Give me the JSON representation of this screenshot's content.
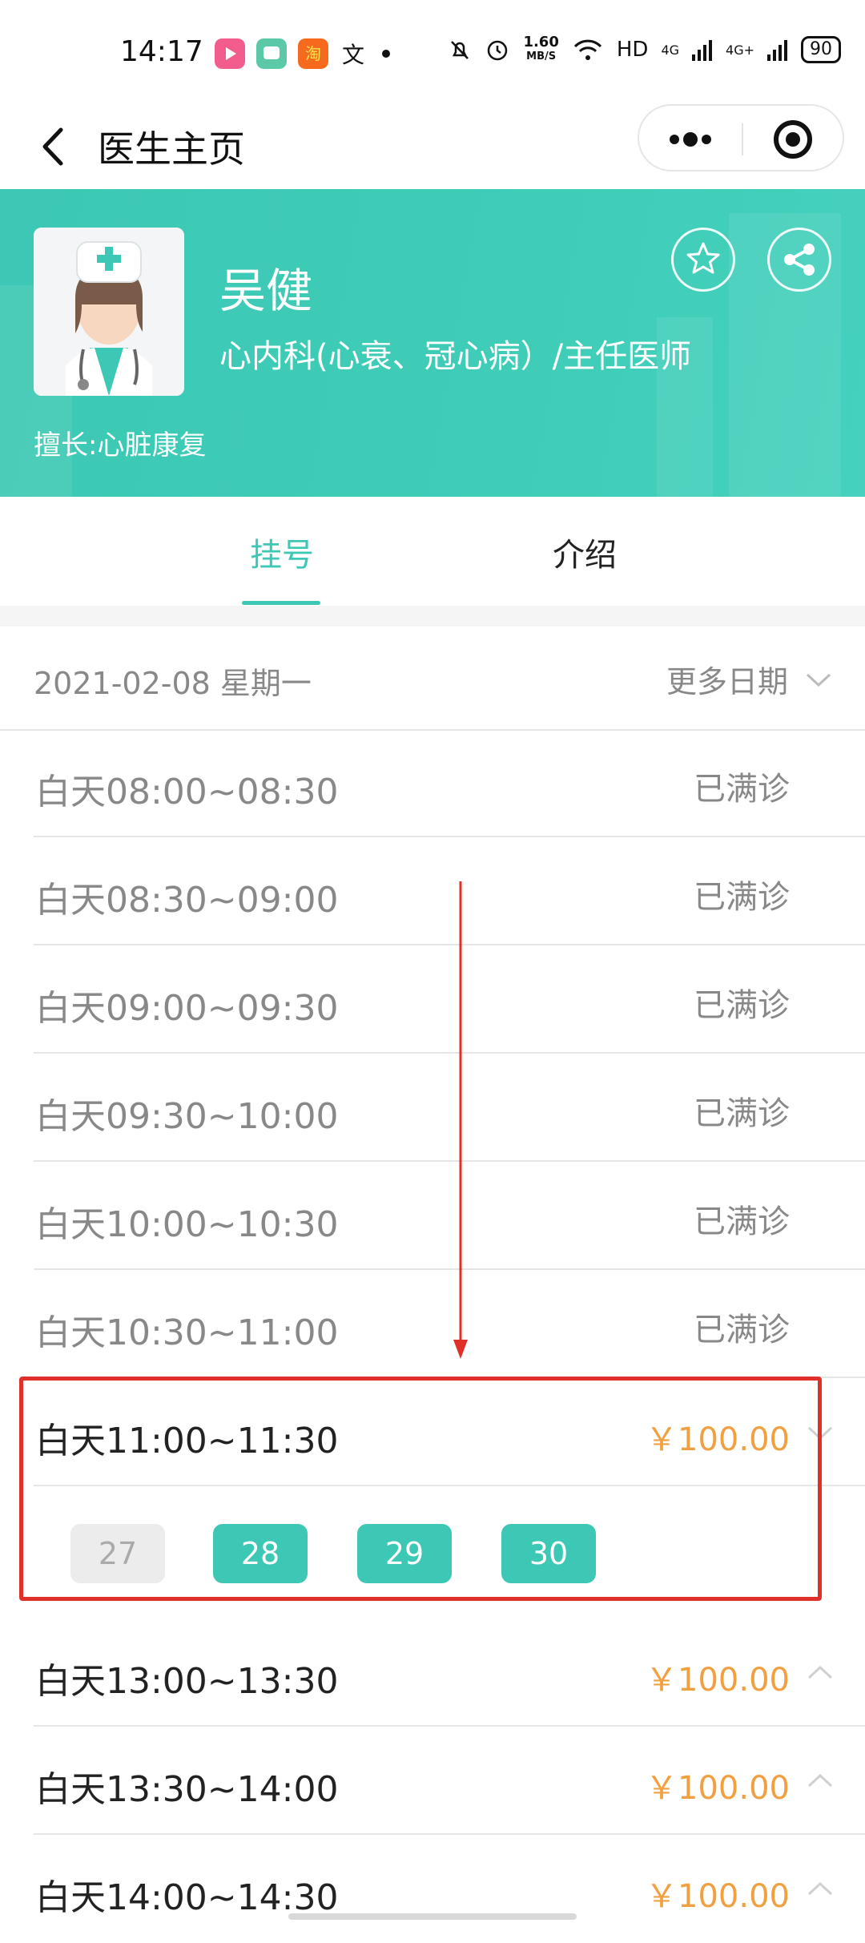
{
  "status_bar": {
    "time": "14:17",
    "net_speed_value": "1.60",
    "net_speed_unit": "MB/S",
    "network": "HD",
    "signal1": "4G",
    "signal2": "4G+",
    "battery": "90",
    "app_icons": [
      "bilibili-icon",
      "chat-app-icon",
      "taobao-icon",
      "translate-icon"
    ]
  },
  "nav": {
    "title": "医生主页",
    "more_icon": "more-dots-icon",
    "close_icon": "target-close-icon"
  },
  "doctor": {
    "name": "吴健",
    "department": "心内科(心衰、冠心病）/主任医师",
    "specialty": "擅长:心脏康复"
  },
  "tabs": [
    {
      "label": "挂号",
      "active": true
    },
    {
      "label": "介绍",
      "active": false
    }
  ],
  "date_bar": {
    "date": "2021-02-08 星期一",
    "more_label": "更多日期"
  },
  "slots": [
    {
      "time": "白天08:00~08:30",
      "status": "已满诊"
    },
    {
      "time": "白天08:30~09:00",
      "status": "已满诊"
    },
    {
      "time": "白天09:00~09:30",
      "status": "已满诊"
    },
    {
      "time": "白天09:30~10:00",
      "status": "已满诊"
    },
    {
      "time": "白天10:00~10:30",
      "status": "已满诊"
    },
    {
      "time": "白天10:30~11:00",
      "status": "已满诊"
    },
    {
      "time": "白天11:00~11:30",
      "price": "￥100.00",
      "expanded": true
    },
    {
      "time": "白天13:00~13:30",
      "price": "￥100.00"
    },
    {
      "time": "白天13:30~14:00",
      "price": "￥100.00"
    },
    {
      "time": "白天14:00~14:30",
      "price": "￥100.00"
    }
  ],
  "numbers": [
    {
      "label": "27",
      "available": false
    },
    {
      "label": "28",
      "available": true
    },
    {
      "label": "29",
      "available": true
    },
    {
      "label": "30",
      "available": true
    }
  ],
  "colors": {
    "accent": "#3cc8b4",
    "price": "#f0a040",
    "annotation": "#e0302a"
  }
}
